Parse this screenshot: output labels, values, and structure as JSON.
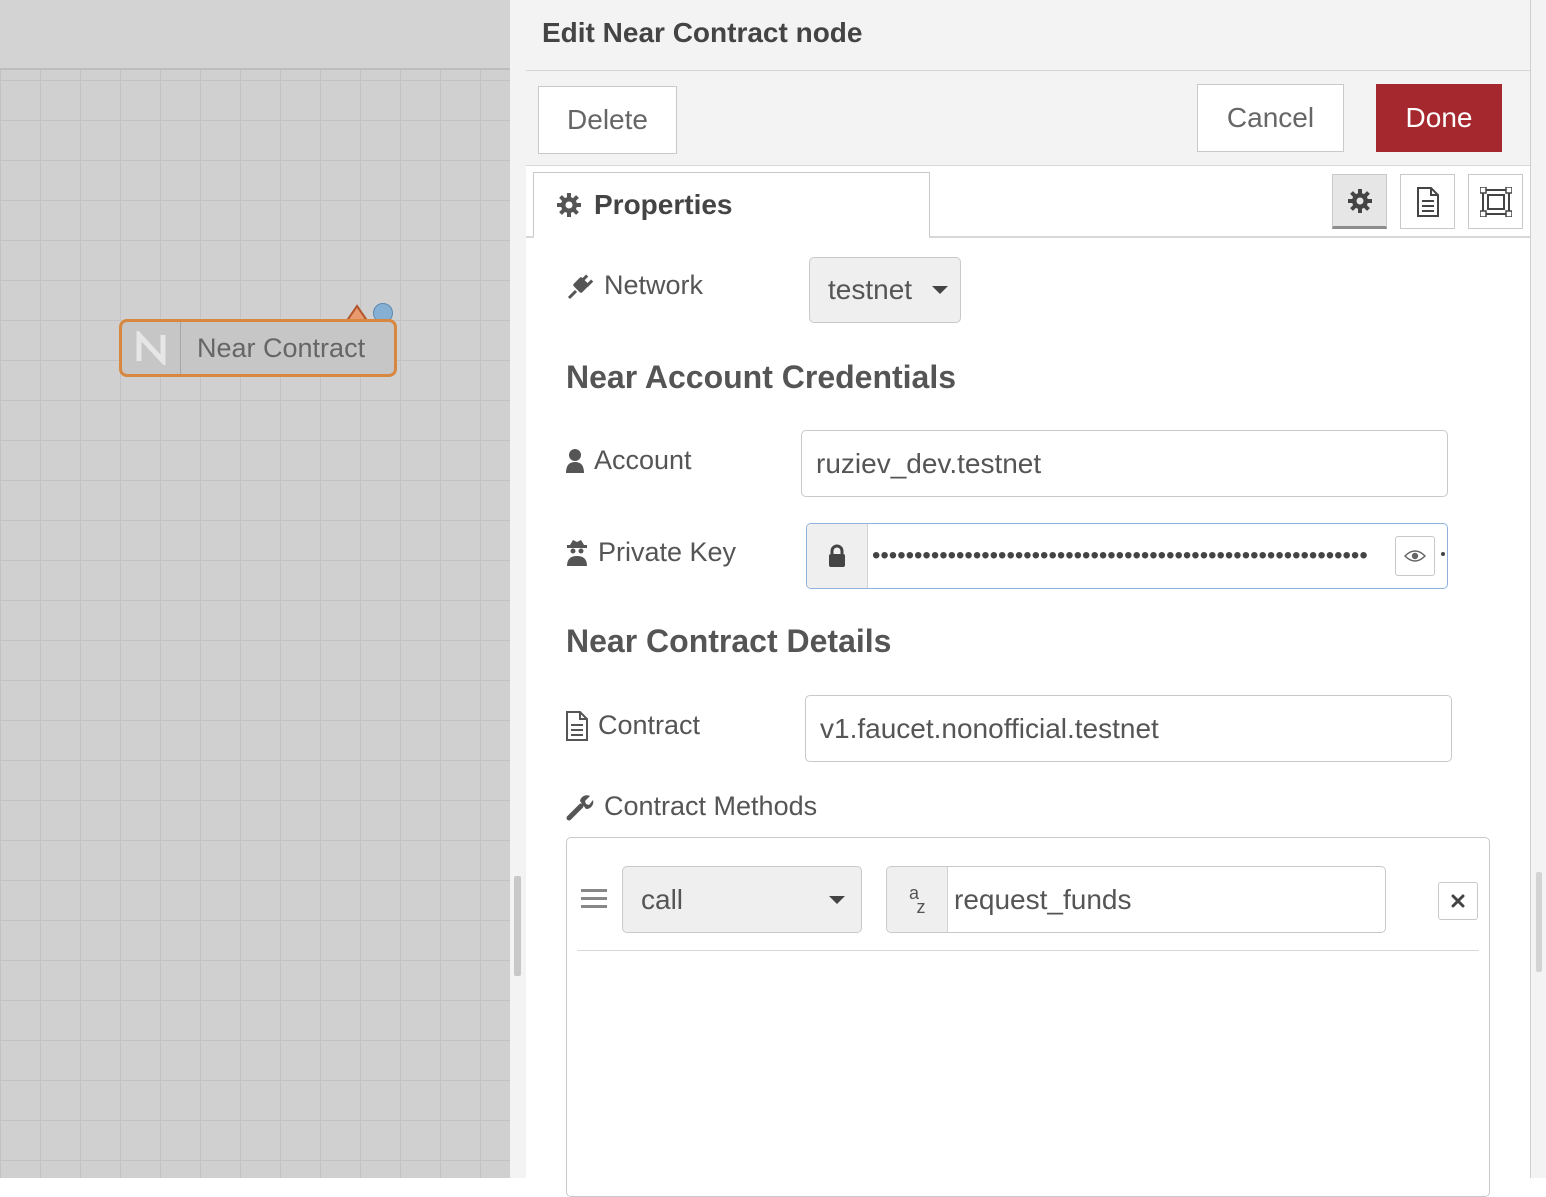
{
  "workspace": {
    "node": {
      "label": "Near Contract",
      "icon": "near-logo-icon",
      "border_color": "#d7873f"
    }
  },
  "tray": {
    "title": "Edit Near Contract node",
    "buttons": {
      "delete": "Delete",
      "cancel": "Cancel",
      "done": "Done"
    },
    "tabs": {
      "properties": "Properties",
      "icons": [
        "gear-icon",
        "document-icon",
        "frame-icon"
      ]
    },
    "form": {
      "network": {
        "label": "Network",
        "value": "testnet",
        "icon": "plug-icon"
      },
      "credentials_heading": "Near Account Credentials",
      "account": {
        "label": "Account",
        "value": "ruziev_dev.testnet",
        "icon": "user-icon"
      },
      "private_key": {
        "label": "Private Key",
        "icon": "spy-icon",
        "masked": "•••••••••••••••••••••••••••••••••••••••••••••••••••••••••••"
      },
      "details_heading": "Near Contract Details",
      "contract": {
        "label": "Contract",
        "value": "v1.faucet.nonofficial.testnet",
        "icon": "file-icon"
      },
      "methods": {
        "label": "Contract Methods",
        "icon": "wrench-icon",
        "items": [
          {
            "type": "call",
            "name": "request_funds"
          }
        ]
      }
    }
  },
  "colors": {
    "accent": "#a4282e",
    "node_border": "#d7873f",
    "status_dot": "#86b0d3"
  }
}
